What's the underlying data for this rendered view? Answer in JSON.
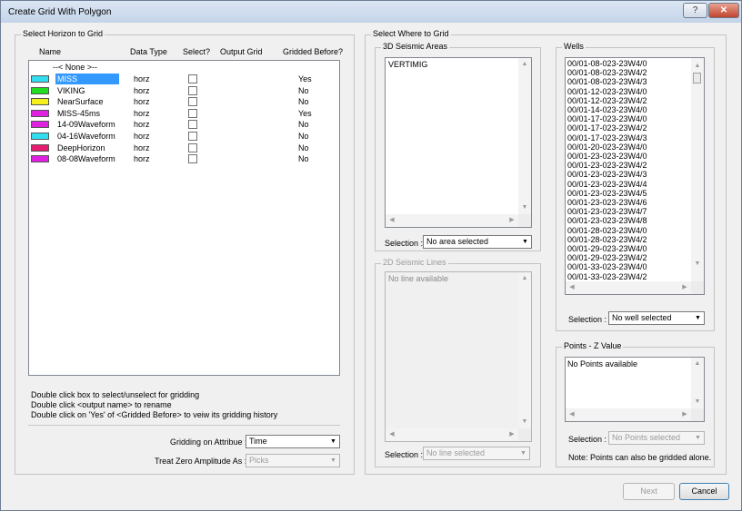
{
  "window": {
    "title": "Create Grid With Polygon",
    "help_label": "?",
    "close_label": "✕"
  },
  "horizon_group": {
    "label": "Select Horizon to Grid",
    "headers": [
      "Name",
      "Data Type",
      "Select?",
      "Output Grid",
      "Gridded Before?"
    ],
    "none_item": "--< None >--",
    "rows": [
      {
        "name": "MISS",
        "type": "horz",
        "gridded": "Yes",
        "color": "#33ddf0",
        "selected": true
      },
      {
        "name": "VIKING",
        "type": "horz",
        "gridded": "No",
        "color": "#22dd22"
      },
      {
        "name": "NearSurface",
        "type": "horz",
        "gridded": "No",
        "color": "#f5f01c"
      },
      {
        "name": "MISS-45ms",
        "type": "horz",
        "gridded": "Yes",
        "color": "#e020e0"
      },
      {
        "name": "14-09Waveform",
        "type": "horz",
        "gridded": "No",
        "color": "#e020e0"
      },
      {
        "name": "04-16Waveform",
        "type": "horz",
        "gridded": "No",
        "color": "#33ddf0"
      },
      {
        "name": "DeepHorizon",
        "type": "horz",
        "gridded": "No",
        "color": "#e81c6e"
      },
      {
        "name": "08-08Waveform",
        "type": "horz",
        "gridded": "No",
        "color": "#e020e0"
      }
    ],
    "help_lines": [
      "Double click box to select/unselect for gridding",
      "Double click <output name> to rename",
      "Double click on 'Yes' of <Gridded Before>  to veiw its gridding history"
    ],
    "attribute_label": "Gridding on Attribue :",
    "attribute_value": "Time",
    "zero_label": "Treat Zero Amplitude As :",
    "zero_value": "Picks"
  },
  "where_group": {
    "label": "Select Where to Grid",
    "seismic3d": {
      "label": "3D Seismic Areas",
      "items": [
        "VERTIMIG"
      ],
      "selection_label": "Selection :",
      "selection_value": "No area selected"
    },
    "seismic2d": {
      "label": "2D Seismic Lines",
      "items": [
        "No line available"
      ],
      "selection_label": "Selection :",
      "selection_value": "No line selected"
    },
    "wells": {
      "label": "Wells",
      "items": [
        "00/01-08-023-23W4/0",
        "00/01-08-023-23W4/2",
        "00/01-08-023-23W4/3",
        "00/01-12-023-23W4/0",
        "00/01-12-023-23W4/2",
        "00/01-14-023-23W4/0",
        "00/01-17-023-23W4/0",
        "00/01-17-023-23W4/2",
        "00/01-17-023-23W4/3",
        "00/01-20-023-23W4/0",
        "00/01-23-023-23W4/0",
        "00/01-23-023-23W4/2",
        "00/01-23-023-23W4/3",
        "00/01-23-023-23W4/4",
        "00/01-23-023-23W4/5",
        "00/01-23-023-23W4/6",
        "00/01-23-023-23W4/7",
        "00/01-23-023-23W4/8",
        "00/01-28-023-23W4/0",
        "00/01-28-023-23W4/2",
        "00/01-29-023-23W4/0",
        "00/01-29-023-23W4/2",
        "00/01-33-023-23W4/0",
        "00/01-33-023-23W4/2"
      ],
      "selection_label": "Selection :",
      "selection_value": "No well selected"
    },
    "points": {
      "label": "Points - Z Value",
      "items": [
        "No Points available"
      ],
      "selection_label": "Selection :",
      "selection_value": "No Points selected",
      "note": "Note: Points can also be gridded alone."
    }
  },
  "footer": {
    "next_label": "Next",
    "cancel_label": "Cancel"
  }
}
